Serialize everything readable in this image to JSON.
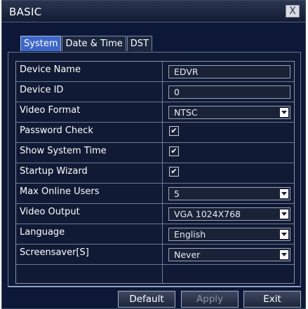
{
  "window": {
    "title": "BASIC",
    "close_glyph": "X"
  },
  "tabs": [
    {
      "label": "System",
      "active": true
    },
    {
      "label": "Date & Time",
      "active": false
    },
    {
      "label": "DST",
      "active": false
    }
  ],
  "settings": {
    "device_name": {
      "label": "Device Name",
      "value": "EDVR"
    },
    "device_id": {
      "label": "Device ID",
      "value": "0"
    },
    "video_format": {
      "label": "Video Format",
      "value": "NTSC"
    },
    "password_check": {
      "label": "Password Check",
      "checked": true
    },
    "show_system_time": {
      "label": "Show System Time",
      "checked": true
    },
    "startup_wizard": {
      "label": "Startup Wizard",
      "checked": true
    },
    "max_online_users": {
      "label": "Max Online Users",
      "value": "5"
    },
    "video_output": {
      "label": "Video Output",
      "value": "VGA 1024X768"
    },
    "language": {
      "label": "Language",
      "value": "English"
    },
    "screensaver": {
      "label": "Screensaver[S]",
      "value": "Never"
    }
  },
  "buttons": {
    "default": "Default",
    "apply": "Apply",
    "exit": "Exit"
  },
  "icons": {
    "check_glyph": "✔"
  },
  "colors": {
    "window_bg": "#0d1838",
    "active_tab": "#3d67c9",
    "text": "#ffffff"
  }
}
